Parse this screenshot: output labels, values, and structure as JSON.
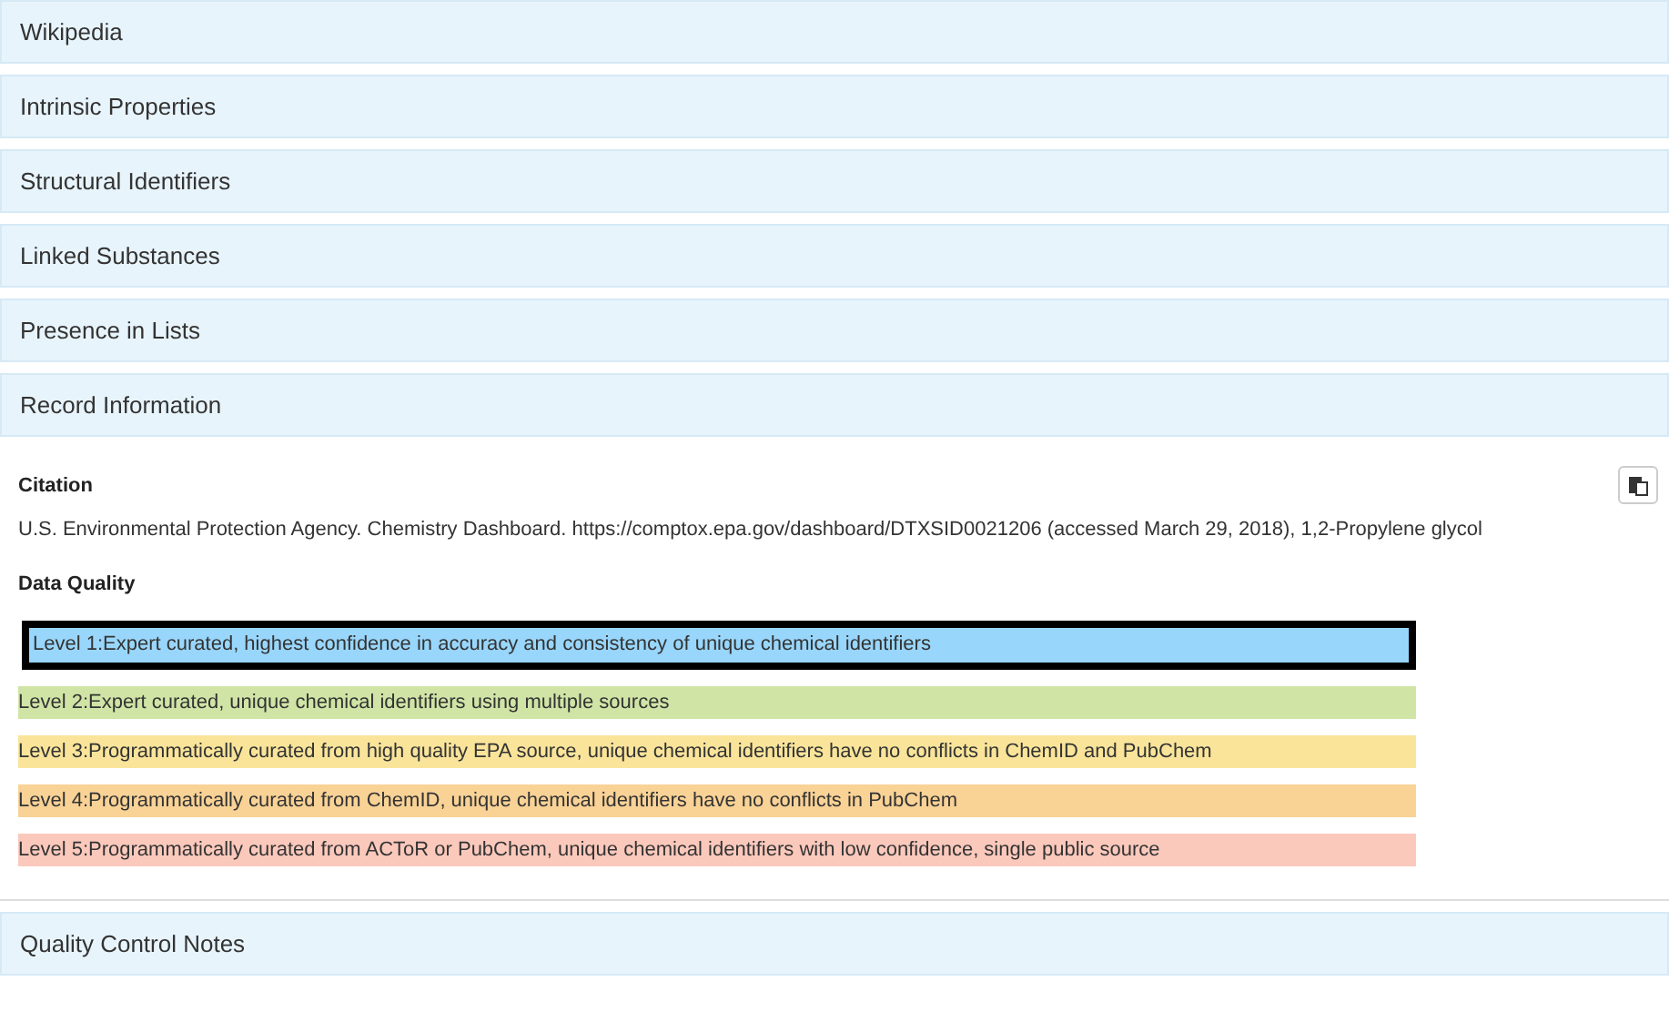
{
  "sections_top": [
    {
      "title": "Wikipedia"
    },
    {
      "title": "Intrinsic Properties"
    },
    {
      "title": "Structural Identifiers"
    },
    {
      "title": "Linked Substances"
    },
    {
      "title": "Presence in Lists"
    },
    {
      "title": "Record Information"
    }
  ],
  "record": {
    "citation_heading": "Citation",
    "citation": "U.S. Environmental Protection Agency. Chemistry Dashboard. https://comptox.epa.gov/dashboard/DTXSID0021206 (accessed March 29, 2018), 1,2-Propylene glycol",
    "quality_heading": "Data Quality",
    "levels": [
      {
        "text": "Level 1:Expert curated, highest confidence in accuracy and consistency of unique chemical identifiers",
        "color": "#99d6fb",
        "selected": true
      },
      {
        "text": "Level 2:Expert curated, unique chemical identifiers using multiple sources",
        "color": "#d0e4a6",
        "selected": false
      },
      {
        "text": "Level 3:Programmatically curated from high quality EPA source, unique chemical identifiers have no conflicts in ChemID and PubChem",
        "color": "#f9e49a",
        "selected": false
      },
      {
        "text": "Level 4:Programmatically curated from ChemID, unique chemical identifiers have no conflicts in PubChem",
        "color": "#f9d296",
        "selected": false
      },
      {
        "text": "Level 5:Programmatically curated from ACToR or PubChem, unique chemical identifiers with low confidence, single public source",
        "color": "#fbc9bc",
        "selected": false
      }
    ]
  },
  "sections_bottom": [
    {
      "title": "Quality Control Notes"
    }
  ]
}
